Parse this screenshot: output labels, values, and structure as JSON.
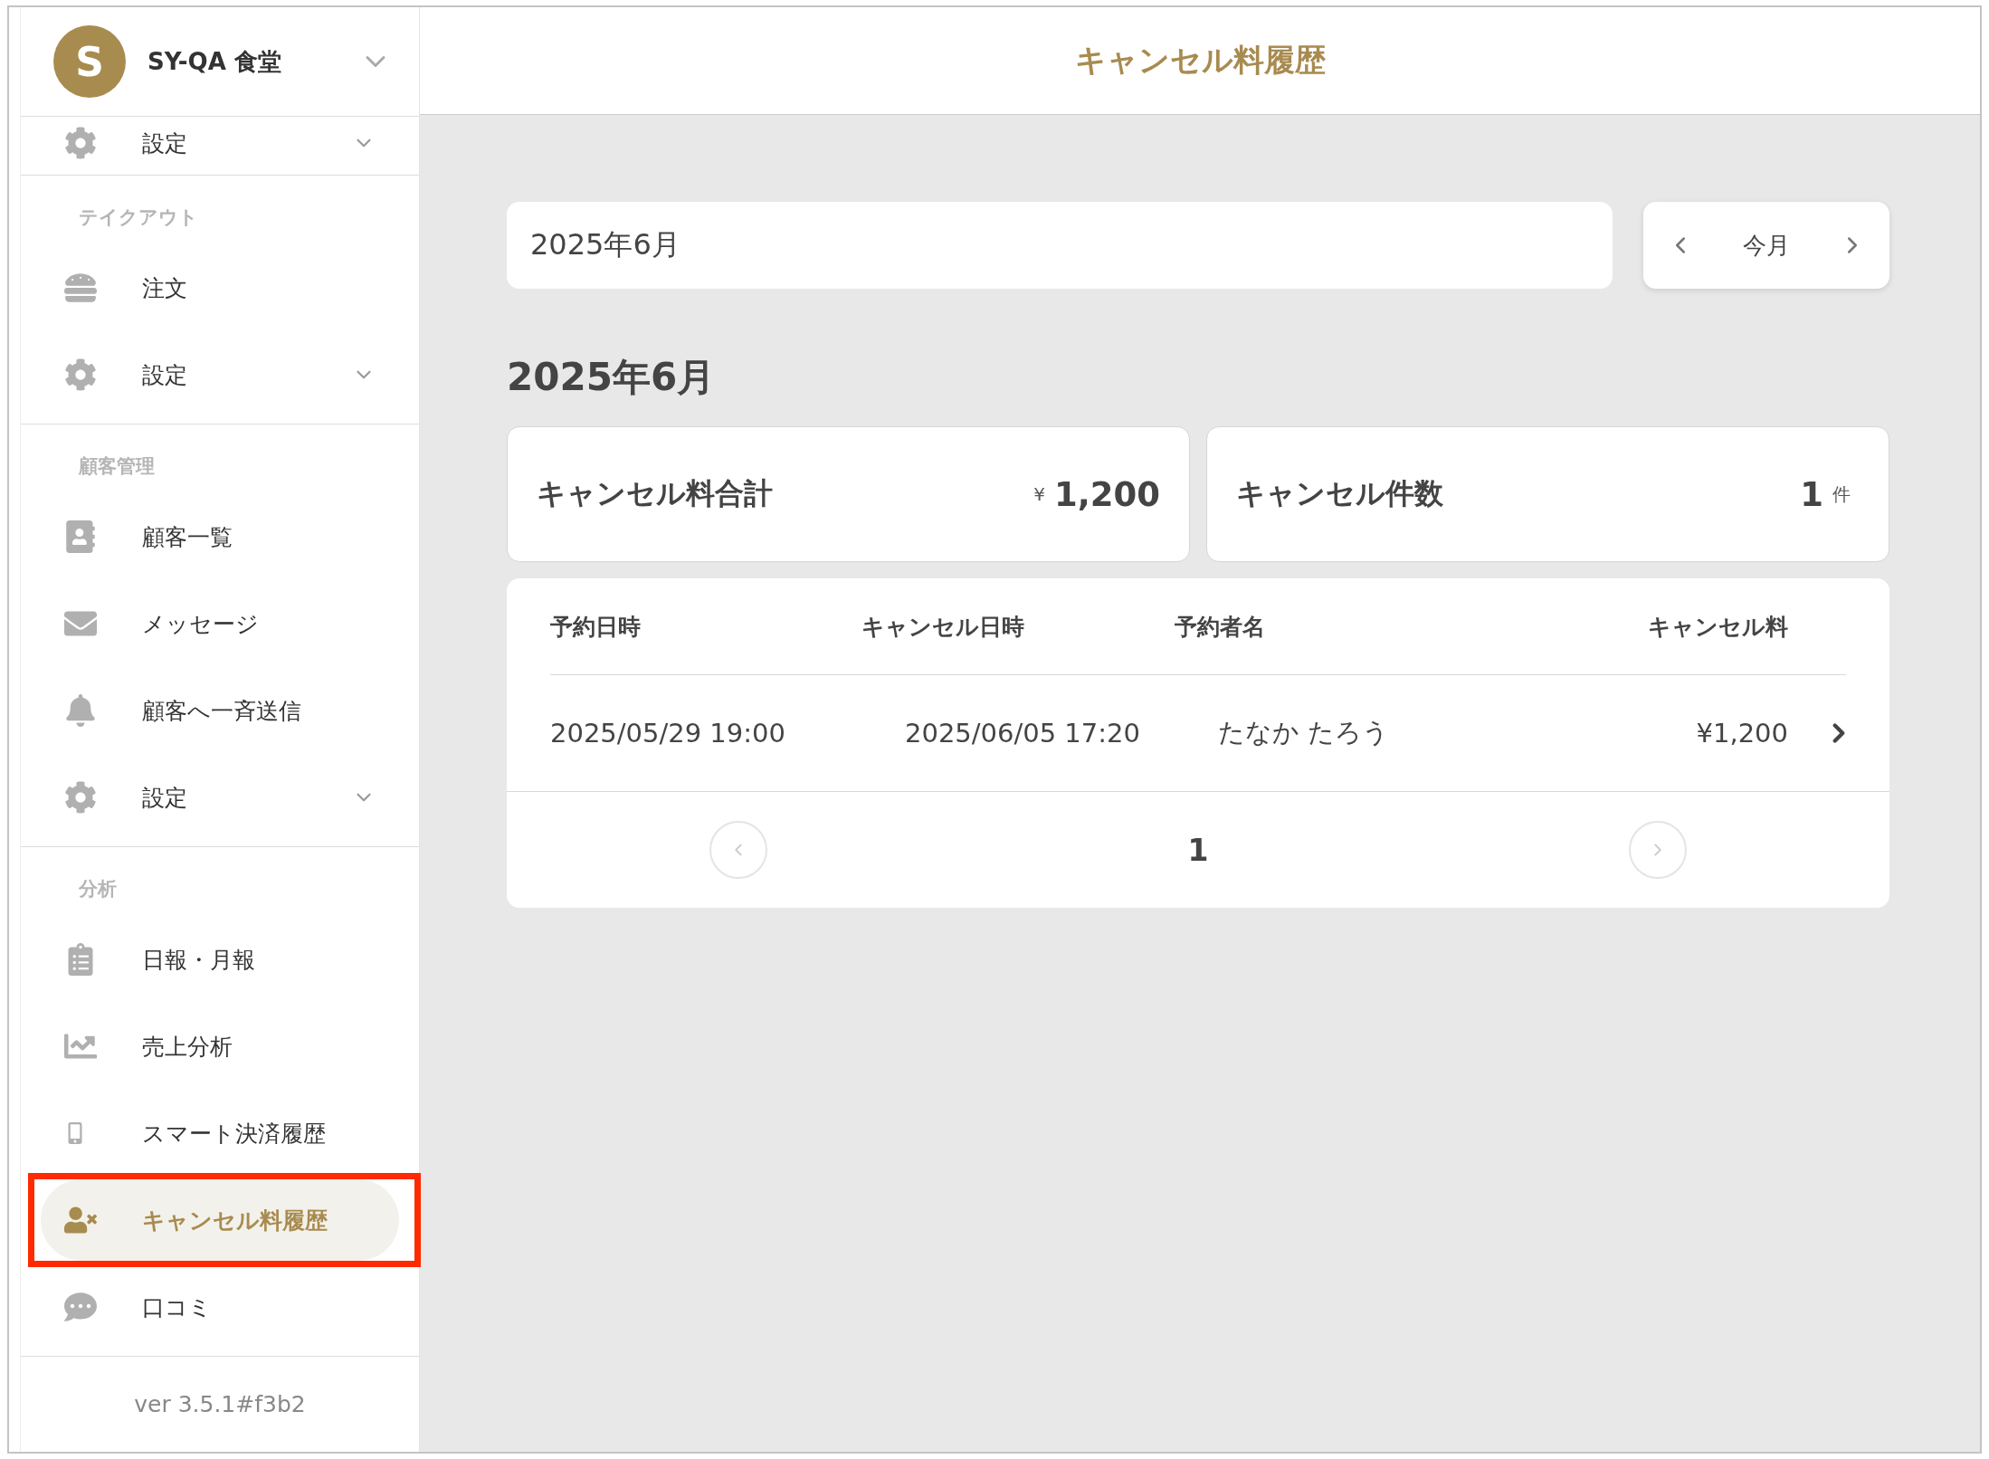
{
  "sidebar": {
    "store": {
      "initial": "S",
      "name": "SY-QA 食堂"
    },
    "groups": [
      {
        "items": [
          {
            "label": "設定",
            "expandable": true,
            "selected": false,
            "annotated": false
          }
        ]
      },
      {
        "heading": "テイクアウト",
        "items": [
          {
            "label": "注文",
            "expandable": false,
            "selected": false,
            "annotated": false
          },
          {
            "label": "設定",
            "expandable": true,
            "selected": false,
            "annotated": false
          }
        ]
      },
      {
        "heading": "顧客管理",
        "items": [
          {
            "label": "顧客一覧",
            "expandable": false,
            "selected": false,
            "annotated": false
          },
          {
            "label": "メッセージ",
            "expandable": false,
            "selected": false,
            "annotated": false
          },
          {
            "label": "顧客へ一斉送信",
            "expandable": false,
            "selected": false,
            "annotated": false
          },
          {
            "label": "設定",
            "expandable": true,
            "selected": false,
            "annotated": false
          }
        ]
      },
      {
        "heading": "分析",
        "items": [
          {
            "label": "日報・月報",
            "expandable": false,
            "selected": false,
            "annotated": false
          },
          {
            "label": "売上分析",
            "expandable": false,
            "selected": false,
            "annotated": false
          },
          {
            "label": "スマート決済履歴",
            "expandable": false,
            "selected": false,
            "annotated": false
          },
          {
            "label": "キャンセル料履歴",
            "expandable": false,
            "selected": true,
            "annotated": true
          },
          {
            "label": "口コミ",
            "expandable": false,
            "selected": false,
            "annotated": false
          }
        ]
      }
    ],
    "version": "ver 3.5.1#f3b2"
  },
  "header": {
    "title": "キャンセル料履歴"
  },
  "month_field": {
    "value": "2025年6月"
  },
  "month_nav": {
    "current": "今月"
  },
  "heading": "2025年6月",
  "summary": [
    {
      "label": "キャンセル料合計",
      "prefix": "¥",
      "value": "1,200"
    },
    {
      "label": "キャンセル件数",
      "value": "1",
      "suffix": "件"
    }
  ],
  "table": {
    "columns": [
      "予約日時",
      "キャンセル日時",
      "予約者名",
      "キャンセル料"
    ],
    "rows": [
      {
        "cells": [
          "2025/05/29 19:00",
          "2025/06/05 17:20",
          "たなか たろう",
          "¥1,200"
        ]
      }
    ]
  },
  "pagination": {
    "page": "1"
  }
}
